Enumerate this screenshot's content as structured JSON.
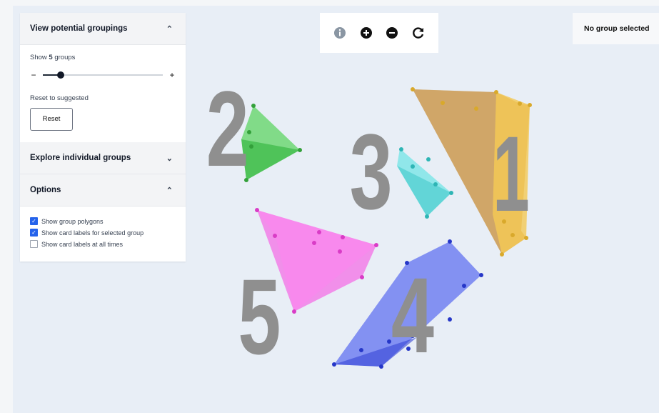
{
  "sidebar": {
    "section1": {
      "title": "View potential groupings",
      "chevron": "chevron-up-icon"
    },
    "show_prefix": "Show",
    "group_count": "5",
    "show_suffix": "groups",
    "slider": {
      "minus": "−",
      "plus": "+",
      "level": 0.15
    },
    "reset_link": "Reset to suggested",
    "reset_button": "Reset",
    "section2": {
      "title": "Explore individual groups",
      "chevron": "chevron-down-icon"
    },
    "section3": {
      "title": "Options",
      "chevron": "chevron-up-icon"
    },
    "options": [
      {
        "label": "Show group polygons",
        "checked": true
      },
      {
        "label": "Show card labels for selected group",
        "checked": true
      },
      {
        "label": "Show card labels at all times",
        "checked": false
      }
    ]
  },
  "toolbar": {
    "tools": [
      "info-icon",
      "zoom-in-icon",
      "zoom-out-icon",
      "refresh-icon"
    ]
  },
  "status": {
    "text": "No group selected"
  },
  "groups": [
    {
      "label": "1",
      "color": "#f0c14b"
    },
    {
      "label": "2",
      "color": "#56d65a"
    },
    {
      "label": "3",
      "color": "#5ee0e0"
    },
    {
      "label": "4",
      "color": "#4f63f0"
    },
    {
      "label": "5",
      "color": "#f25ee3"
    }
  ]
}
